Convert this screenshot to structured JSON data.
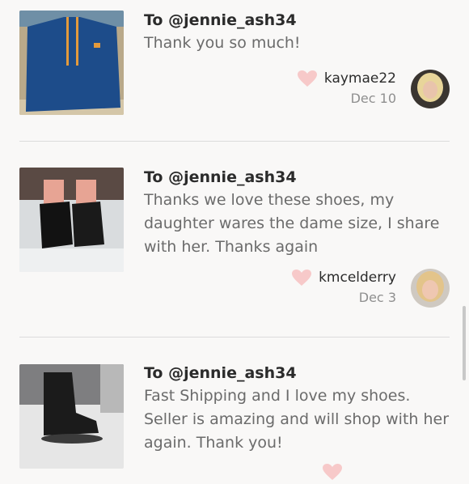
{
  "reviews": [
    {
      "to": "To @jennie_ash34",
      "message": "Thank you so much!",
      "user": "kaymae22",
      "date": "Dec 10"
    },
    {
      "to": "To @jennie_ash34",
      "message": "Thanks we love these shoes, my daughter wares the dame size, I share with her. Thanks again",
      "user": "kmcelderry",
      "date": "Dec 3"
    },
    {
      "to": "To @jennie_ash34",
      "message": "Fast Shipping and I love my shoes. Seller is amazing and will shop with her again. Thank you!",
      "user": "",
      "date": ""
    }
  ],
  "colors": {
    "heart": "#f7c9c9",
    "divider": "#dcdcdc",
    "background": "#f9f8f7"
  },
  "icons": {
    "like": "heart-icon"
  }
}
